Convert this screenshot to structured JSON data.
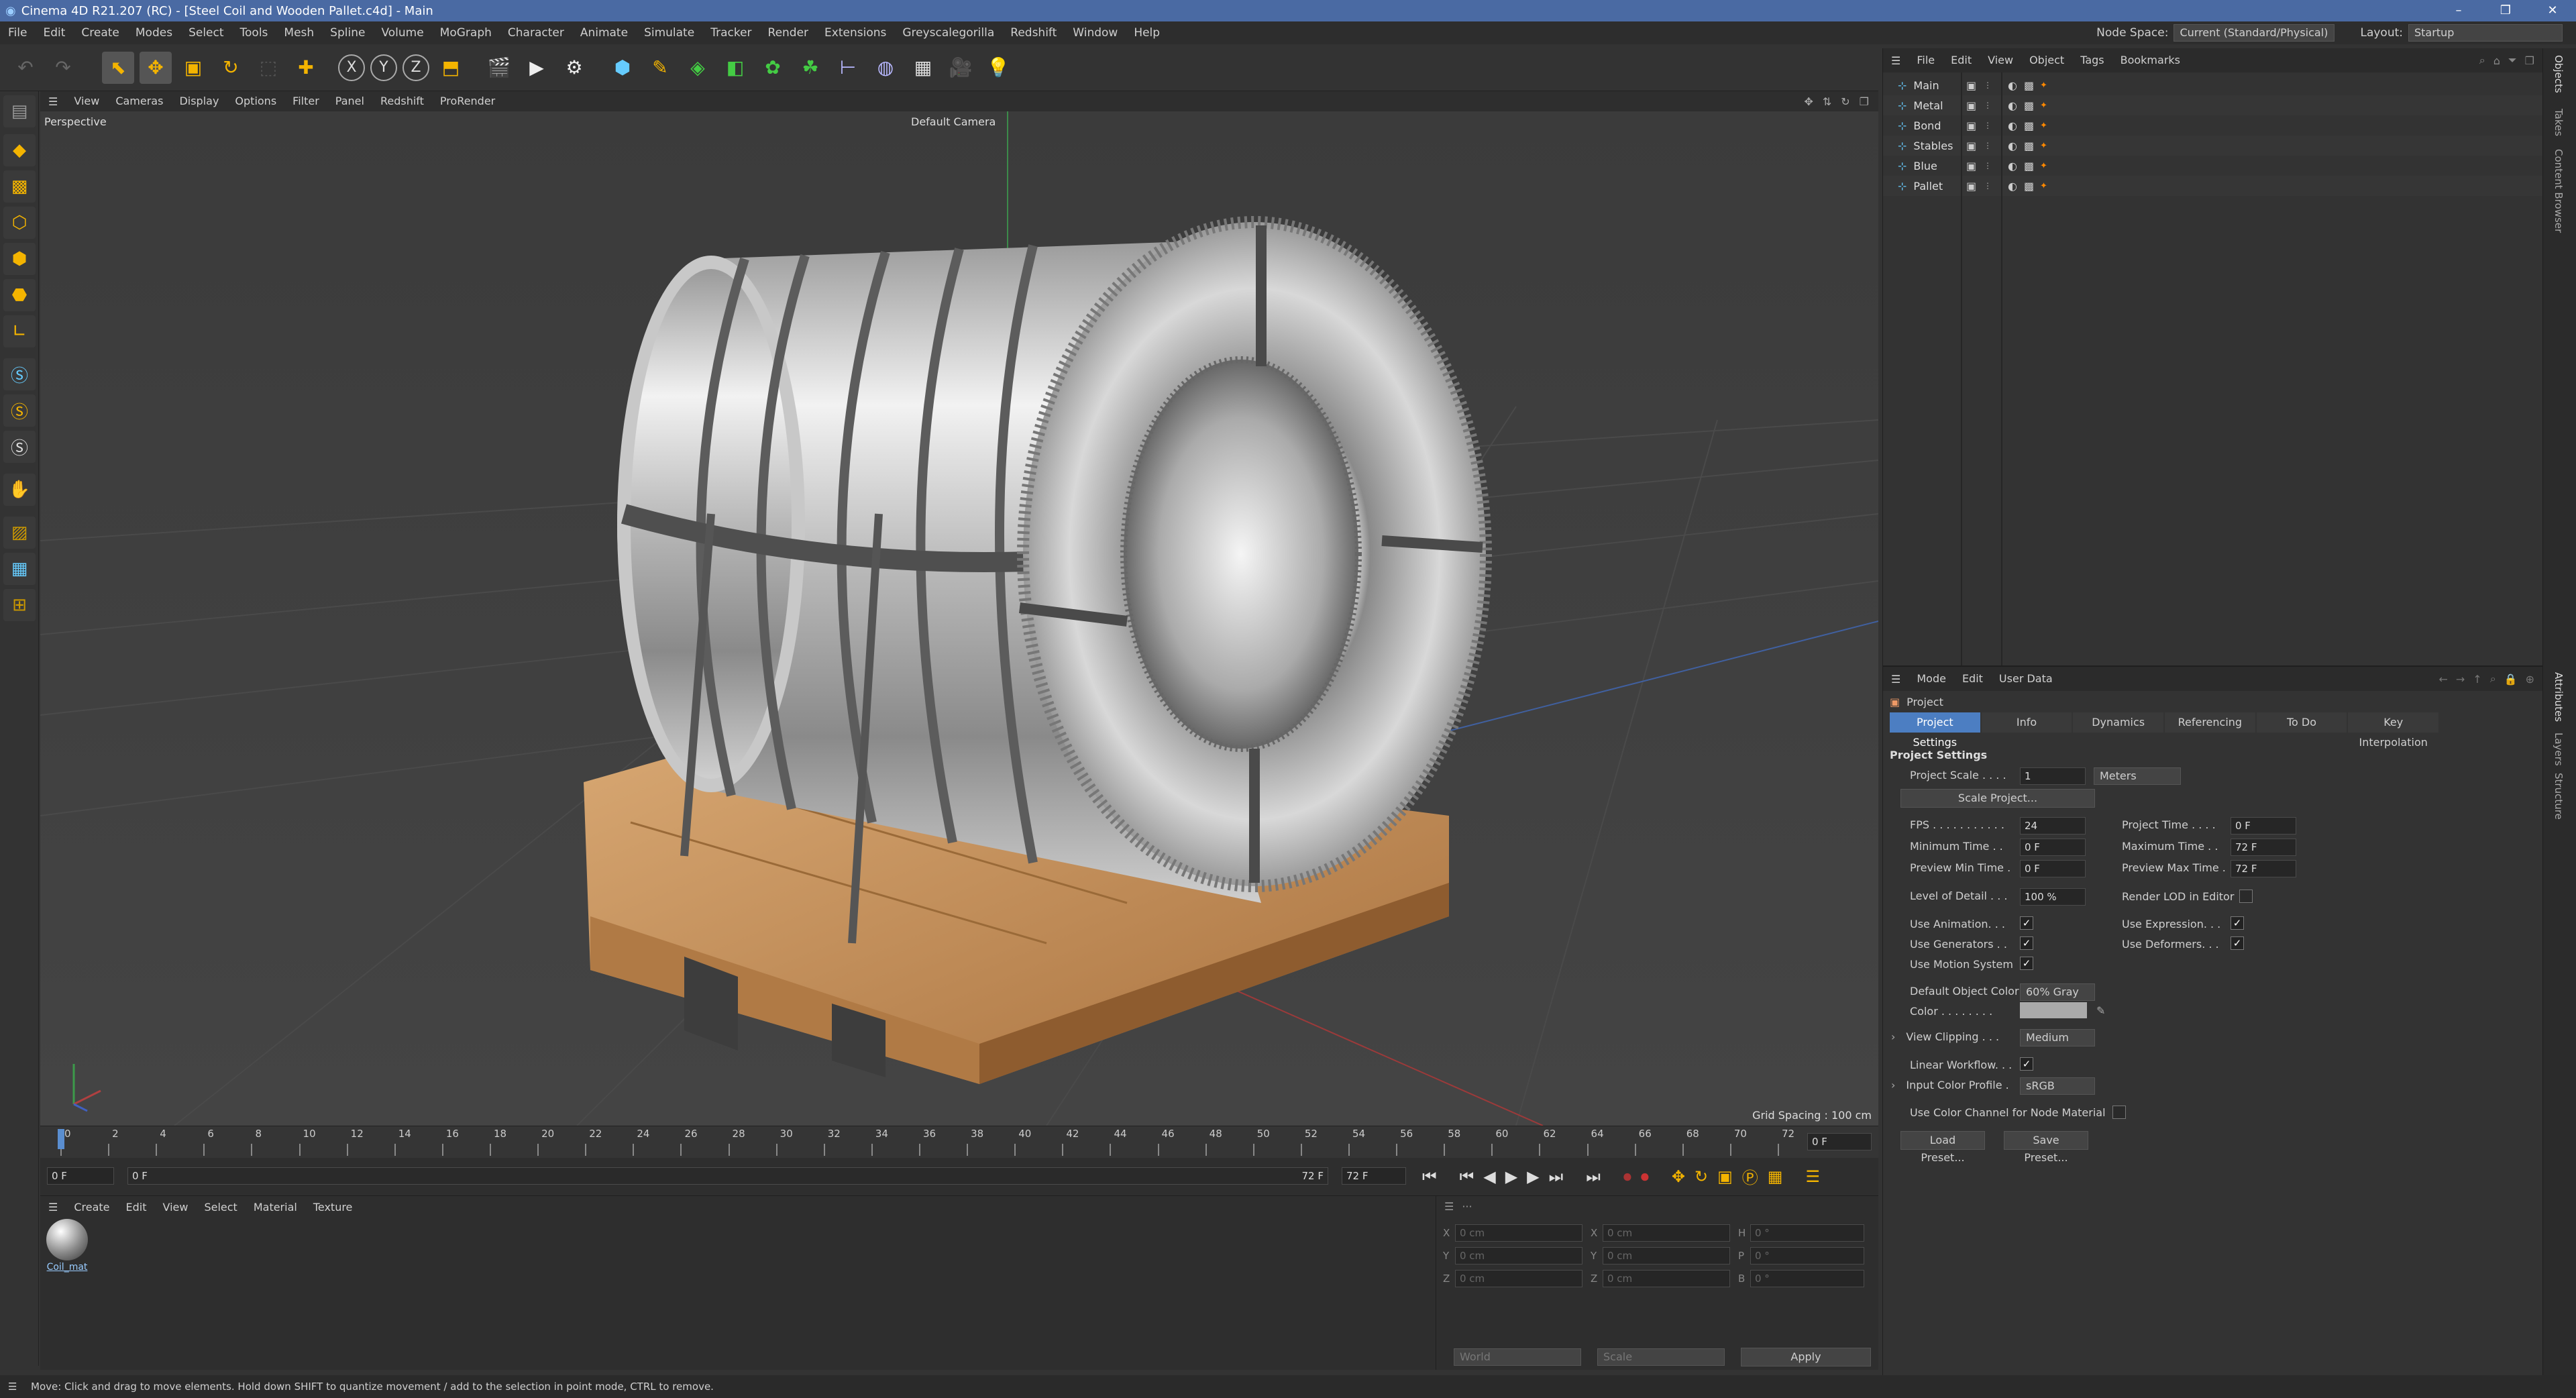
{
  "window": {
    "title": "Cinema 4D R21.207 (RC) - [Steel Coil and Wooden Pallet.c4d] - Main"
  },
  "menu": {
    "items": [
      "File",
      "Edit",
      "Create",
      "Modes",
      "Select",
      "Tools",
      "Mesh",
      "Spline",
      "Volume",
      "MoGraph",
      "Character",
      "Animate",
      "Simulate",
      "Tracker",
      "Render",
      "Extensions",
      "Greyscalegorilla",
      "Redshift",
      "Window",
      "Help"
    ],
    "node_space_label": "Node Space:",
    "node_space_value": "Current (Standard/Physical)",
    "layout_label": "Layout:",
    "layout_value": "Startup"
  },
  "toolbar": {
    "axes": [
      "X",
      "Y",
      "Z"
    ]
  },
  "viewport": {
    "menu": [
      "View",
      "Cameras",
      "Display",
      "Options",
      "Filter",
      "Panel",
      "Redshift",
      "ProRender"
    ],
    "label": "Perspective",
    "camera": "Default Camera",
    "grid_spacing": "Grid Spacing : 100 cm"
  },
  "timeline": {
    "ticks": [
      "0",
      "2",
      "4",
      "6",
      "8",
      "10",
      "12",
      "14",
      "16",
      "18",
      "20",
      "22",
      "24",
      "26",
      "28",
      "30",
      "32",
      "34",
      "36",
      "38",
      "40",
      "42",
      "44",
      "46",
      "48",
      "50",
      "52",
      "54",
      "56",
      "58",
      "60",
      "62",
      "64",
      "66",
      "68",
      "70",
      "72"
    ],
    "end_field": "0 F"
  },
  "playbar": {
    "start": "0 F",
    "current": "0 F",
    "end_label": "72 F",
    "end_field": "72 F"
  },
  "material_manager": {
    "menu": [
      "Create",
      "Edit",
      "View",
      "Select",
      "Material",
      "Texture"
    ],
    "material_name": "Coil_mat"
  },
  "coordinates": {
    "rows": [
      {
        "a_label": "X",
        "a_val": "0 cm",
        "b_label": "X",
        "b_val": "0 cm",
        "c_label": "H",
        "c_val": "0 °"
      },
      {
        "a_label": "Y",
        "a_val": "0 cm",
        "b_label": "Y",
        "b_val": "0 cm",
        "c_label": "P",
        "c_val": "0 °"
      },
      {
        "a_label": "Z",
        "a_val": "0 cm",
        "b_label": "Z",
        "b_val": "0 cm",
        "c_label": "B",
        "c_val": "0 °"
      }
    ],
    "world": "World",
    "scale": "Scale",
    "apply": "Apply"
  },
  "status": "Move: Click and drag to move elements. Hold down SHIFT to quantize movement / add to the selection in point mode, CTRL to remove.",
  "object_manager": {
    "menu": [
      "File",
      "Edit",
      "View",
      "Object",
      "Tags",
      "Bookmarks"
    ],
    "objects": [
      "Main",
      "Metal",
      "Bond",
      "Stables",
      "Blue",
      "Pallet"
    ]
  },
  "attributes": {
    "menu": [
      "Mode",
      "Edit",
      "User Data"
    ],
    "project_label": "Project",
    "tabs": [
      "Project Settings",
      "Info",
      "Dynamics",
      "Referencing",
      "To Do",
      "Key Interpolation"
    ],
    "section": "Project Settings",
    "project_scale_label": "Project Scale . . . .",
    "project_scale": "1",
    "project_scale_unit": "Meters",
    "scale_project_btn": "Scale Project...",
    "fps_label": "FPS . . . . . . . . . . .",
    "fps": "24",
    "project_time_label": "Project Time . . . .",
    "project_time": "0 F",
    "min_time_label": "Minimum Time . .",
    "min_time": "0 F",
    "max_time_label": "Maximum Time . .",
    "max_time": "72 F",
    "prev_min_label": "Preview Min Time .",
    "prev_min": "0 F",
    "prev_max_label": "Preview Max Time .",
    "prev_max": "72 F",
    "lod_label": "Level of Detail . . .",
    "lod": "100 %",
    "render_lod_label": "Render LOD in Editor",
    "use_anim_label": "Use Animation. . .",
    "use_expr_label": "Use Expression. . .",
    "use_gen_label": "Use Generators . .",
    "use_def_label": "Use Deformers. . .",
    "use_motion_label": "Use Motion System",
    "def_color_label": "Default Object Color",
    "def_color": "60% Gray",
    "color_label": "Color . . . . . . . .",
    "view_clip_label": "View Clipping . . .",
    "view_clip": "Medium",
    "linear_label": "Linear Workflow. . .",
    "input_profile_label": "Input Color Profile .",
    "input_profile": "sRGB",
    "color_channel_label": "Use Color Channel for Node Material",
    "load_preset": "Load Preset...",
    "save_preset": "Save Preset..."
  },
  "side_tabs": {
    "top": [
      "Objects",
      "Takes",
      "Content Browser"
    ],
    "bottom": [
      "Attributes",
      "Layers",
      "Structure"
    ]
  }
}
